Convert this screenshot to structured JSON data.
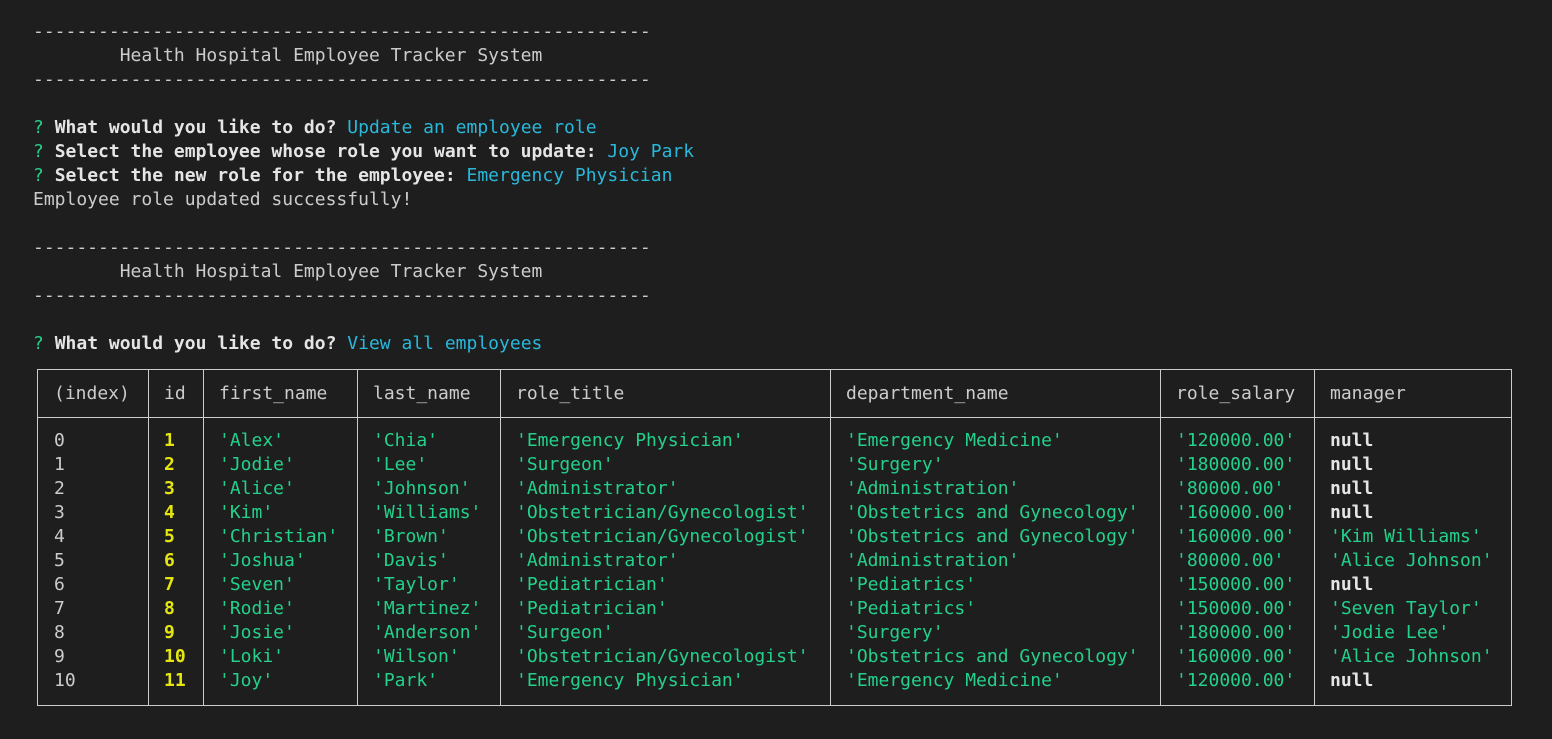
{
  "header": {
    "separator": "---------------------------------------------------------",
    "title": "        Health Hospital Employee Tracker System"
  },
  "session1": {
    "prompts": [
      {
        "marker": "?",
        "question": "What would you like to do?",
        "answer": "Update an employee role"
      },
      {
        "marker": "?",
        "question": "Select the employee whose role you want to update:",
        "answer": "Joy Park"
      },
      {
        "marker": "?",
        "question": "Select the new role for the employee:",
        "answer": "Emergency Physician"
      }
    ],
    "result": "Employee role updated successfully!"
  },
  "session2": {
    "prompts": [
      {
        "marker": "?",
        "question": "What would you like to do?",
        "answer": "View all employees"
      }
    ]
  },
  "table": {
    "columns": [
      "(index)",
      "id",
      "first_name",
      "last_name",
      "role_title",
      "department_name",
      "role_salary",
      "manager"
    ],
    "rows": [
      [
        "0",
        "1",
        "'Alex'",
        "'Chia'",
        "'Emergency Physician'",
        "'Emergency Medicine'",
        "'120000.00'",
        "null"
      ],
      [
        "1",
        "2",
        "'Jodie'",
        "'Lee'",
        "'Surgeon'",
        "'Surgery'",
        "'180000.00'",
        "null"
      ],
      [
        "2",
        "3",
        "'Alice'",
        "'Johnson'",
        "'Administrator'",
        "'Administration'",
        "'80000.00'",
        "null"
      ],
      [
        "3",
        "4",
        "'Kim'",
        "'Williams'",
        "'Obstetrician/Gynecologist'",
        "'Obstetrics and Gynecology'",
        "'160000.00'",
        "null"
      ],
      [
        "4",
        "5",
        "'Christian'",
        "'Brown'",
        "'Obstetrician/Gynecologist'",
        "'Obstetrics and Gynecology'",
        "'160000.00'",
        "'Kim Williams'"
      ],
      [
        "5",
        "6",
        "'Joshua'",
        "'Davis'",
        "'Administrator'",
        "'Administration'",
        "'80000.00'",
        "'Alice Johnson'"
      ],
      [
        "6",
        "7",
        "'Seven'",
        "'Taylor'",
        "'Pediatrician'",
        "'Pediatrics'",
        "'150000.00'",
        "null"
      ],
      [
        "7",
        "8",
        "'Rodie'",
        "'Martinez'",
        "'Pediatrician'",
        "'Pediatrics'",
        "'150000.00'",
        "'Seven Taylor'"
      ],
      [
        "8",
        "9",
        "'Josie'",
        "'Anderson'",
        "'Surgeon'",
        "'Surgery'",
        "'180000.00'",
        "'Jodie Lee'"
      ],
      [
        "9",
        "10",
        "'Loki'",
        "'Wilson'",
        "'Obstetrician/Gynecologist'",
        "'Obstetrics and Gynecology'",
        "'160000.00'",
        "'Alice Johnson'"
      ],
      [
        "10",
        "11",
        "'Joy'",
        "'Park'",
        "'Emergency Physician'",
        "'Emergency Medicine'",
        "'120000.00'",
        "null"
      ]
    ]
  },
  "colors": {
    "background": "#1e1e1e",
    "prompt_marker": "#23d18b",
    "answer": "#29b8db",
    "string_value": "#23d18b",
    "number_value": "#e5e510",
    "text": "#cccccc"
  }
}
